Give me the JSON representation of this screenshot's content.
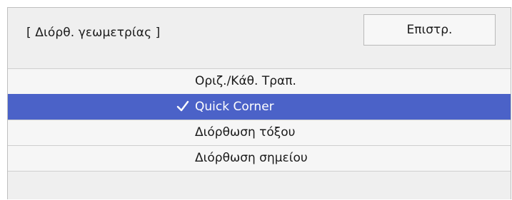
{
  "header": {
    "title": "[ Διόρθ. γεωμετρίας ]",
    "back_label": "Επιστρ."
  },
  "menu": {
    "items": [
      {
        "label": "Οριζ./Κάθ. Τραπ.",
        "selected": false
      },
      {
        "label": "Quick Corner",
        "selected": true,
        "icon": "checkmark-icon"
      },
      {
        "label": "Διόρθωση τόξου",
        "selected": false
      },
      {
        "label": "Διόρθωση σημείου",
        "selected": false
      }
    ]
  },
  "colors": {
    "selected_bg": "#4b62c8",
    "selected_text": "#ffffff",
    "panel_bg": "#efefef",
    "item_bg": "#f6f6f6"
  }
}
